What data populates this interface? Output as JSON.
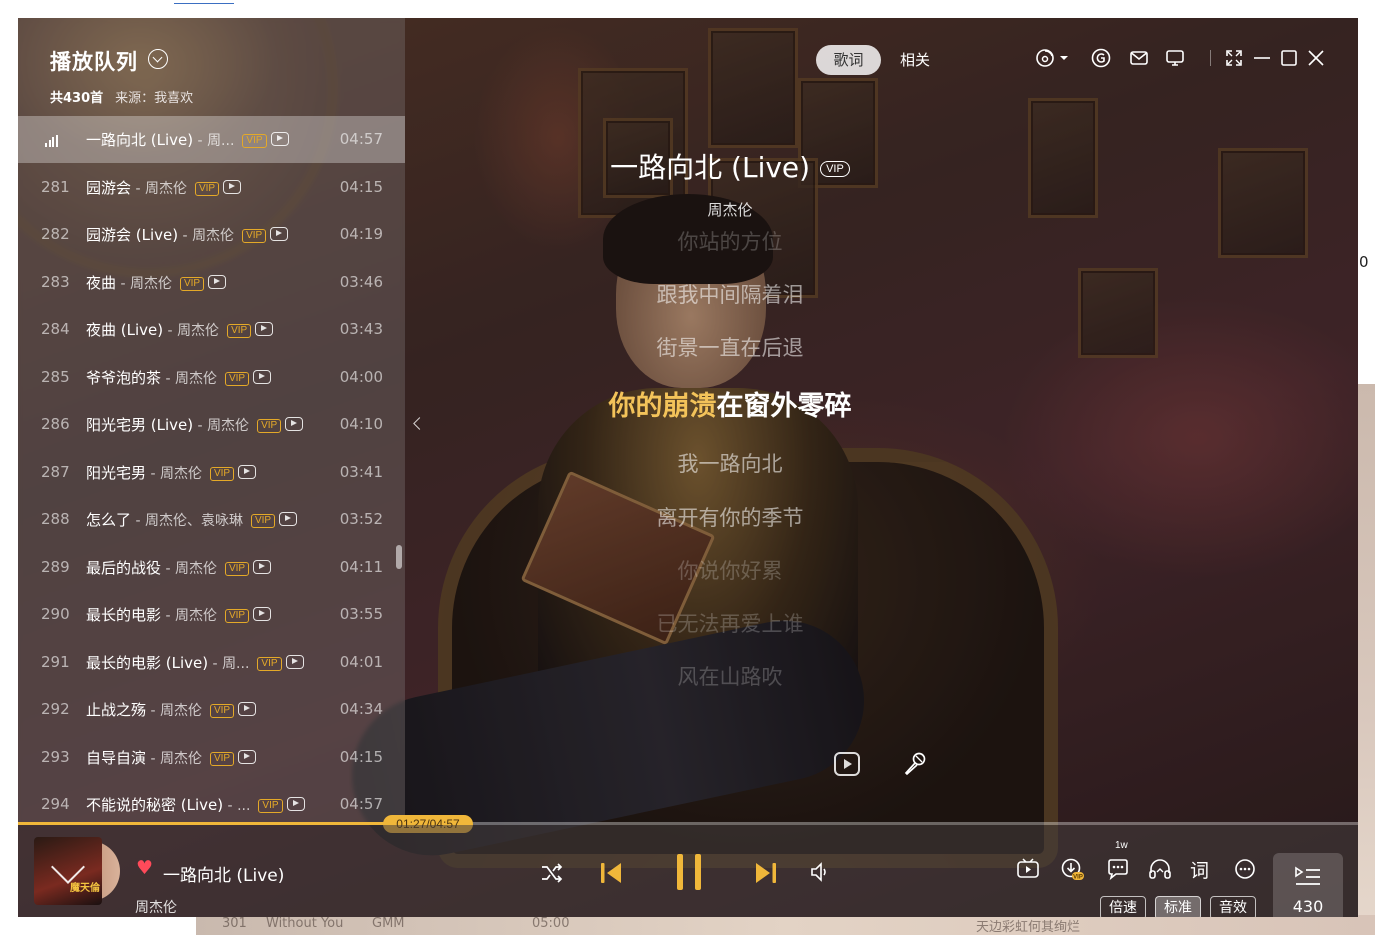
{
  "window": {
    "queue_title": "播放队列",
    "queue_count": "共430首",
    "queue_source": "来源：我喜欢"
  },
  "tabs": {
    "lyrics": "歌词",
    "related": "相关"
  },
  "top_icons": [
    "disc-icon",
    "chevron-down-icon",
    "coin-icon",
    "mail-icon",
    "monitor-icon",
    "fullscreen-icon",
    "minimize-icon",
    "maximize-icon",
    "close-icon"
  ],
  "playlist": [
    {
      "num": "",
      "title": "一路向北 (Live)",
      "artist": "周...",
      "duration": "04:57",
      "vip": "VIP",
      "active": true
    },
    {
      "num": "281",
      "title": "园游会",
      "artist": "周杰伦",
      "duration": "04:15",
      "vip": "VIP"
    },
    {
      "num": "282",
      "title": "园游会 (Live)",
      "artist": "周杰伦",
      "duration": "04:19",
      "vip": "VIP"
    },
    {
      "num": "283",
      "title": "夜曲",
      "artist": "周杰伦",
      "duration": "03:46",
      "vip": "VIP"
    },
    {
      "num": "284",
      "title": "夜曲 (Live)",
      "artist": "周杰伦",
      "duration": "03:43",
      "vip": "VIP"
    },
    {
      "num": "285",
      "title": "爷爷泡的茶",
      "artist": "周杰伦",
      "duration": "04:00",
      "vip": "VIP"
    },
    {
      "num": "286",
      "title": "阳光宅男 (Live)",
      "artist": "周杰伦",
      "duration": "04:10",
      "vip": "VIP"
    },
    {
      "num": "287",
      "title": "阳光宅男",
      "artist": "周杰伦",
      "duration": "03:41",
      "vip": "VIP"
    },
    {
      "num": "288",
      "title": "怎么了",
      "artist": "周杰伦、袁咏琳",
      "duration": "03:52",
      "vip": "VIP"
    },
    {
      "num": "289",
      "title": "最后的战役",
      "artist": "周杰伦",
      "duration": "04:11",
      "vip": "VIP"
    },
    {
      "num": "290",
      "title": "最长的电影",
      "artist": "周杰伦",
      "duration": "03:55",
      "vip": "VIP"
    },
    {
      "num": "291",
      "title": "最长的电影 (Live)",
      "artist": "周...",
      "duration": "04:01",
      "vip": "VIP"
    },
    {
      "num": "292",
      "title": "止战之殇",
      "artist": "周杰伦",
      "duration": "04:34",
      "vip": "VIP"
    },
    {
      "num": "293",
      "title": "自导自演",
      "artist": "周杰伦",
      "duration": "04:15",
      "vip": "VIP"
    },
    {
      "num": "294",
      "title": "不能说的秘密 (Live)",
      "artist": "...",
      "duration": "04:57",
      "vip": "VIP"
    }
  ],
  "now_playing": {
    "title": "一路向北 (Live)",
    "vip": "VIP",
    "artist": "周杰伦",
    "progress_time": "01:27/04:57",
    "progress_fraction": 0.293
  },
  "lyrics": [
    {
      "text": "你站的方位",
      "state": "faint"
    },
    {
      "text": "跟我中间隔着泪",
      "state": "normal"
    },
    {
      "text": "街景一直在后退",
      "state": "normal"
    },
    {
      "sung": "你的崩溃",
      "rest": "在窗外零碎",
      "state": "current"
    },
    {
      "text": "我一路向北",
      "state": "normal"
    },
    {
      "text": "离开有你的季节",
      "state": "normal"
    },
    {
      "text": "你说你好累",
      "state": "faint"
    },
    {
      "text": "已无法再爱上谁",
      "state": "faint"
    },
    {
      "text": "风在山路吹",
      "state": "faint"
    }
  ],
  "controls": {
    "right_badge": "1w",
    "lyric_word": "词",
    "speed": "倍速",
    "quality": "标准",
    "effects": "音效",
    "queue_total": "430"
  },
  "background": {
    "right_number": "0",
    "bottom_texts": [
      "301",
      "Without You",
      "GMM",
      "05:00",
      "天边彩虹何其绚烂"
    ]
  },
  "colors": {
    "accent": "#f0b73a",
    "vip": "#e4a928",
    "heart": "#ff4a5a"
  }
}
